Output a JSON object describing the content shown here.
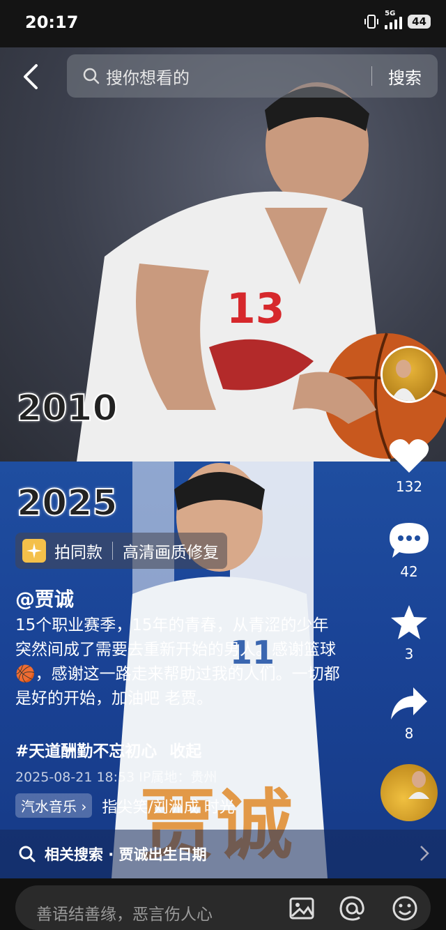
{
  "status_bar": {
    "time": "20:17",
    "network": "5G",
    "battery": "44"
  },
  "search": {
    "placeholder": "搜你想看的",
    "button": "搜索"
  },
  "video": {
    "year_top": "2010",
    "year_bottom": "2025",
    "jersey_top": "13",
    "jersey_bottom": "11",
    "overlay_name": "贾诚"
  },
  "actions": {
    "likes": "132",
    "comments": "42",
    "favorites": "3",
    "shares": "8"
  },
  "same_style": {
    "label": "拍同款",
    "enhance": "高清画质修复"
  },
  "post": {
    "author": "@贾诚",
    "description": "15个职业赛季，15年的青春，从青涩的少年突然间成了需要去重新开始的男人。感谢篮球🏀，感谢这一路走来帮助过我的人们。一切都是好的开始，加油吧 老贾。",
    "hashtag": "#天道酬勤不忘初心",
    "collapse": "收起",
    "date": "2025-08-21 18:53",
    "ip_location": "IP属地：贵州"
  },
  "music": {
    "tag": "汽水音乐",
    "title": "指尖笑/刘洲成   时光"
  },
  "related_search": {
    "label": "相关搜索 · 贾诚出生日期"
  },
  "comment": {
    "placeholder": "善语结善缘，恶言伤人心"
  }
}
